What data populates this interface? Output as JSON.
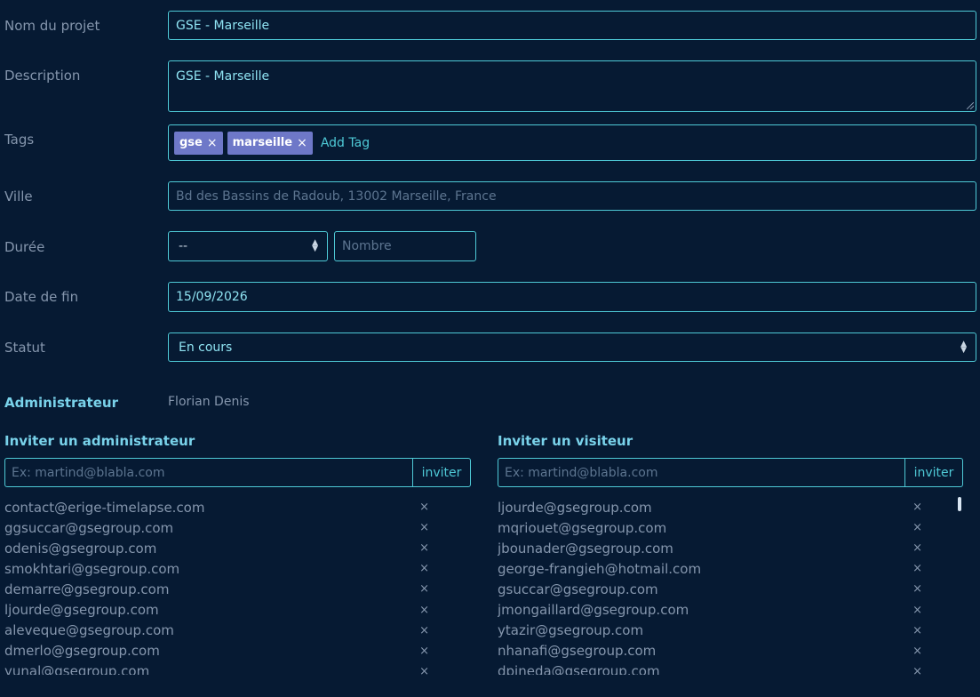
{
  "form": {
    "project_name_label": "Nom du projet",
    "project_name_value": "GSE - Marseille",
    "description_label": "Description",
    "description_value": "GSE - Marseille",
    "tags_label": "Tags",
    "tags": [
      {
        "text": "gse",
        "remove": "×"
      },
      {
        "text": "marseille",
        "remove": "×"
      }
    ],
    "add_tag_placeholder": "Add Tag",
    "ville_label": "Ville",
    "ville_placeholder": "Bd des Bassins de Radoub, 13002 Marseille, France",
    "duree_label": "Durée",
    "duree_select_value": "--",
    "duree_number_placeholder": "Nombre",
    "date_fin_label": "Date de fin",
    "date_fin_value": "15/09/2026",
    "statut_label": "Statut",
    "statut_value": "En cours"
  },
  "admin": {
    "label": "Administrateur",
    "name": "Florian Denis"
  },
  "invite_admin": {
    "title": "Inviter un administrateur",
    "placeholder": "Ex: martind@blabla.com",
    "button": "inviter",
    "emails": [
      "contact@erige-timelapse.com",
      "ggsuccar@gsegroup.com",
      "odenis@gsegroup.com",
      "smokhtari@gsegroup.com",
      "demarre@gsegroup.com",
      "ljourde@gsegroup.com",
      "aleveque@gsegroup.com",
      "dmerlo@gsegroup.com",
      "yunal@gsegroup.com"
    ]
  },
  "invite_visitor": {
    "title": "Inviter un visiteur",
    "placeholder": "Ex: martind@blabla.com",
    "button": "inviter",
    "emails": [
      "ljourde@gsegroup.com",
      "mqriouet@gsegroup.com",
      "jbounader@gsegroup.com",
      "george-frangieh@hotmail.com",
      "gsuccar@gsegroup.com",
      "jmongaillard@gsegroup.com",
      "ytazir@gsegroup.com",
      "nhanafi@gsegroup.com",
      "dpineda@gsegroup.com"
    ]
  },
  "remove_glyph": "×",
  "select_arrow_up": "▲",
  "select_arrow_down": "▼",
  "colors": {
    "background": "#061a33",
    "accent": "#4ec9d6",
    "tag": "#6e78c8",
    "label": "#8596ad"
  }
}
